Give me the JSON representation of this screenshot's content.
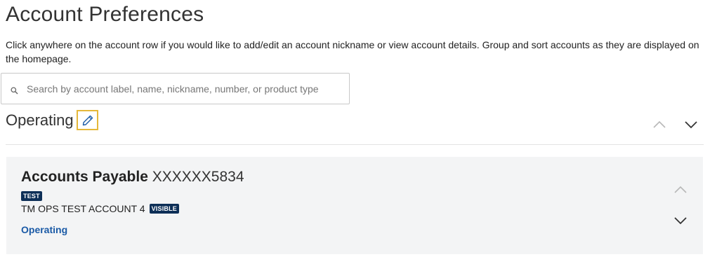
{
  "page": {
    "title": "Account Preferences",
    "intro": "Click anywhere on the account row if you would like to add/edit an account nickname or view account details. Group and sort accounts as they are displayed on the homepage."
  },
  "search": {
    "placeholder": "Search by account label, name, nickname, number, or product type",
    "value": "",
    "icon": "search-icon"
  },
  "group": {
    "title": "Operating",
    "edit_icon": "pencil-icon",
    "move_up_icon": "chevron-up-icon",
    "move_down_icon": "chevron-down-icon"
  },
  "accounts": [
    {
      "name": "Accounts Payable",
      "number": "XXXXXX5834",
      "label_badge": "TEST",
      "description": "TM OPS TEST ACCOUNT 4",
      "visibility_badge": "VISIBLE",
      "group_link": "Operating"
    }
  ],
  "colors": {
    "badge_bg": "#0d2f57",
    "link": "#1a5aa6",
    "edit_focus": "#e5b83a",
    "card_bg": "#f3f4f5"
  }
}
